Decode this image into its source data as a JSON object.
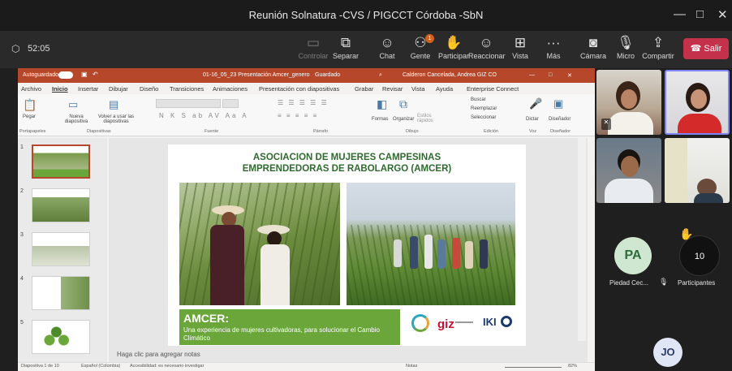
{
  "window": {
    "title": "Reunión Solnatura -CVS / PIGCCT Córdoba -SbN",
    "minimize": "—",
    "maximize": "□",
    "close": "✕"
  },
  "meeting": {
    "timer": "52:05",
    "toolbar": [
      {
        "label": "Controlar",
        "icon": "control-icon"
      },
      {
        "label": "Separar",
        "icon": "popout-icon"
      },
      {
        "label": "Chat",
        "icon": "chat-icon"
      },
      {
        "label": "Gente",
        "icon": "people-icon",
        "badge": "1"
      },
      {
        "label": "Participar",
        "icon": "raise-hand-icon"
      },
      {
        "label": "Reaccionar",
        "icon": "react-icon"
      },
      {
        "label": "Vista",
        "icon": "view-icon"
      },
      {
        "label": "Más",
        "icon": "more-icon"
      },
      {
        "label": "Cámara",
        "icon": "camera-off-icon"
      },
      {
        "label": "Micro",
        "icon": "mic-off-icon"
      },
      {
        "label": "Compartir",
        "icon": "share-icon"
      }
    ],
    "leave": "Salir"
  },
  "ppt": {
    "autosave": "Autoguardado",
    "filename": "01-16_05_23 Presentación Amcer_genero",
    "saved": "Guardado",
    "user": "Calderon Cancelada, Andrea GIZ CO",
    "menu": [
      "Archivo",
      "Inicio",
      "Insertar",
      "Dibujar",
      "Diseño",
      "Transiciones",
      "Animaciones",
      "Presentación con diapositivas",
      "Grabar",
      "Revisar",
      "Vista",
      "Ayuda",
      "Enterprise Connect"
    ],
    "ribbon_groups": [
      "Portapapeles",
      "Diapositivas",
      "Fuente",
      "Párrafo",
      "Dibujo",
      "Edición",
      "Voz",
      "Diseñador"
    ],
    "ribbon_labels": {
      "paste": "Pegar",
      "new_slide": "Nueva diapositiva",
      "reuse": "Volver a usar las diapositivas",
      "shapes": "Formas",
      "organize": "Organizar",
      "quick_styles": "Estilos rápidos",
      "find": "Buscar",
      "replace": "Reemplazar",
      "select": "Seleccionar",
      "dictate": "Dictar",
      "designer": "Diseñador"
    },
    "slide_numbers": [
      "1",
      "2",
      "3",
      "4",
      "5"
    ],
    "notes_placeholder": "Haga clic para agregar notas",
    "status": {
      "slide": "Diapositiva 1 de 10",
      "language": "Español (Colombia)",
      "accessibility": "Accesibilidad: es necesario investigar",
      "notes": "Notas",
      "zoom": "82%"
    },
    "slide": {
      "title_line1": "ASOCIACION DE MUJERES CAMPESINAS",
      "title_line2": "EMPRENDEDORAS DE RABOLARGO (AMCER)",
      "box_title": "AMCER:",
      "box_text": "Una experiencia de mujeres cultivadoras, para solucionar el Cambio Climático",
      "logo_giz": "giz",
      "logo_iki": "IKI"
    }
  },
  "participants": {
    "pa_initials": "PA",
    "pa_name": "Piedad Cec...",
    "count": "10",
    "count_label": "Participantes",
    "jo_initials": "JO"
  }
}
